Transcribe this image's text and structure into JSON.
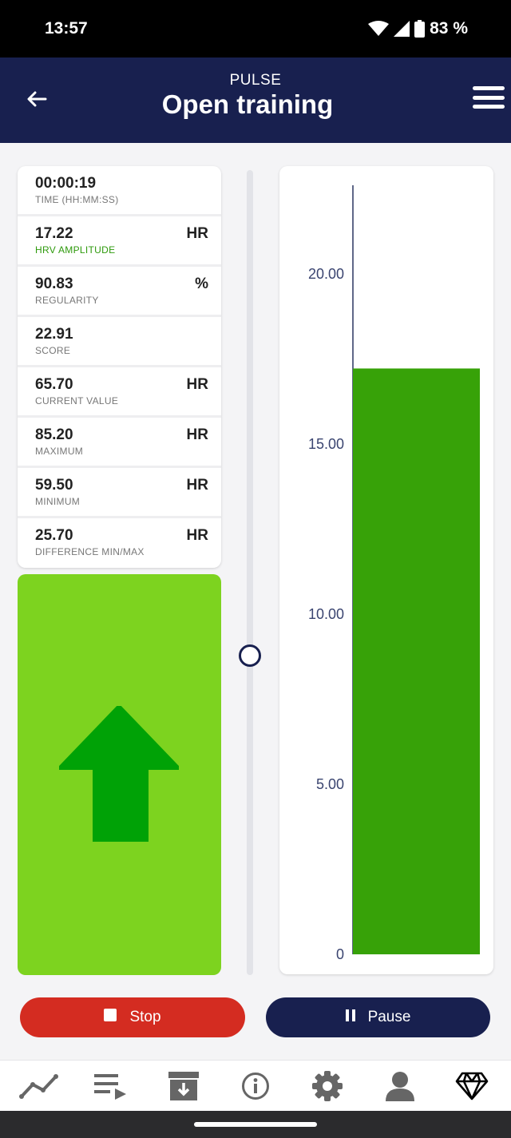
{
  "status_bar": {
    "time": "13:57",
    "battery": "83 %"
  },
  "header": {
    "subtitle": "PULSE",
    "title": "Open training"
  },
  "stats": [
    {
      "value": "00:00:19",
      "label": "TIME (HH:MM:SS)",
      "unit": ""
    },
    {
      "value": "17.22",
      "label": "HRV AMPLITUDE",
      "unit": "HR"
    },
    {
      "value": "90.83",
      "label": "REGULARITY",
      "unit": "%"
    },
    {
      "value": "22.91",
      "label": "SCORE",
      "unit": ""
    },
    {
      "value": "65.70",
      "label": "CURRENT VALUE",
      "unit": "HR"
    },
    {
      "value": "85.20",
      "label": "MAXIMUM",
      "unit": "HR"
    },
    {
      "value": "59.50",
      "label": "MINIMUM",
      "unit": "HR"
    },
    {
      "value": "25.70",
      "label": "DIFFERENCE MIN/MAX",
      "unit": "HR"
    }
  ],
  "colors": {
    "navy": "#18204f",
    "bar_green": "#37a208",
    "panel_green": "#7dd31f",
    "arrow_green": "#00a206",
    "stop_red": "#d42c21",
    "label_green": "#2e9a0c"
  },
  "indicator": {
    "icon": "arrow-up-icon"
  },
  "chart_data": {
    "type": "bar",
    "values": [
      17.22
    ],
    "ylim": [
      0,
      22.6
    ],
    "yticks": [
      "0",
      "5.00",
      "10.00",
      "15.00",
      "20.00"
    ],
    "ytick_values": [
      0,
      5,
      10,
      15,
      20
    ],
    "bar_color": "#37a208"
  },
  "actions": {
    "stop_label": "Stop",
    "pause_label": "Pause"
  },
  "nav": [
    "chart-icon",
    "playlist-icon",
    "archive-icon",
    "info-icon",
    "settings-icon",
    "profile-icon",
    "diamond-icon"
  ]
}
